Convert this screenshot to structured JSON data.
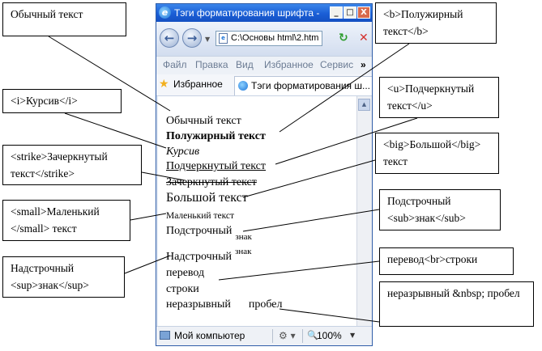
{
  "browser": {
    "title": "Тэги форматирования шрифта - ...",
    "min_glyph": "_",
    "max_glyph": "□",
    "close_glyph": "X",
    "back_glyph": "←",
    "forward_glyph": "→",
    "dropdown_glyph": "▼",
    "address": "C:\\Основы html\\2.htm",
    "refresh_glyph": "↻",
    "stop_glyph": "✕",
    "menu": [
      "Файл",
      "Правка",
      "Вид",
      "Избранное",
      "Сервис"
    ],
    "menu_more": "»",
    "favorites_label": "Избранное",
    "tab_title": "Тэги форматирования ш...",
    "status_text": "Мой компьютер",
    "zoom": "100%"
  },
  "page": {
    "normal": "Обычный текст",
    "bold": "Полужирный текст",
    "italic": "Курсив",
    "underline": "Подчеркнутый текст",
    "strike": "Зачеркнутый текст",
    "big": "Большой текст",
    "small": "Маленький текст",
    "sub_base": "Подстрочный",
    "sub_mark": "знак",
    "sup_base": "Надстрочный",
    "sup_mark": "знак",
    "br_line1": "перевод",
    "br_line2": "строки",
    "nbsp_word1": "неразрывный",
    "nbsp_word2": "пробел"
  },
  "callouts": {
    "normal": "Обычный текст",
    "italic": "<i>Курсив</i>",
    "strike": "<strike>Зачеркнутый текст</strike>",
    "small": "<small>Маленький </small> текст",
    "sup": "Надстрочный <sup>знак</sup>",
    "bold": "<b>Полужирный текст</b>",
    "underline": "<u>Подчеркнутый текст</u>",
    "big": "<big>Большой</big> текст",
    "sub": "Подстрочный <sub>знак</sub>",
    "br": "перевод<br>строки",
    "nbsp": "неразрывный &nbsp; пробел"
  }
}
